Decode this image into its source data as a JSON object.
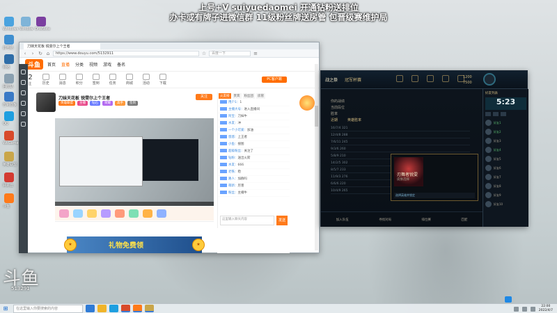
{
  "overlay": {
    "line1": "上号+V suiyuedaomei  开通钻粉送排位",
    "line2": "办卡或有牌子进微信群 11级粉丝牌送房管  包晋级赛维护局"
  },
  "desktop_icons": [
    {
      "label": "Windows",
      "color": "#4aa3df"
    },
    {
      "label": "Window",
      "color": "#7fb4d8"
    },
    {
      "label": "OneNote",
      "color": "#7b3fa0"
    },
    {
      "label": "此电脑",
      "color": "#3f8fd0"
    },
    {
      "label": "网络",
      "color": "#2f6ea8"
    },
    {
      "label": "回收站",
      "color": "#8aa0b0"
    },
    {
      "label": "控制面板",
      "color": "#3a7ac6"
    },
    {
      "label": "QQ",
      "color": "#1e9fe0"
    },
    {
      "label": "WeGame",
      "color": "#d84a2a"
    },
    {
      "label": "英雄联盟",
      "color": "#c9a64a"
    },
    {
      "label": "网易云",
      "color": "#d33a31"
    },
    {
      "label": "斗鱼",
      "color": "#ff7a1a"
    }
  ],
  "browser": {
    "tab_label": "刀妹天花板 锐雯尔上个王者",
    "url": "https://www.douyu.com/5132911",
    "search_placeholder": "百度一下",
    "site": {
      "logo": "斗鱼",
      "nav": [
        "首页",
        "直播",
        "分类",
        "视频",
        "游戏",
        "备名"
      ],
      "active_nav": "直播"
    },
    "icon_row": {
      "count": "12",
      "count_label": "关注",
      "items": [
        "历史",
        "消息",
        "积分",
        "签到",
        "任务",
        "商城",
        "活动",
        "下载"
      ]
    },
    "pc_button": "PC客户端",
    "room": {
      "title": "刀妹天花板 锐雯尔上个王者",
      "follow": "关注",
      "tags": [
        {
          "text": "英雄联盟",
          "color": "#ff7a1a"
        },
        {
          "text": "主播",
          "color": "#e84a8a"
        },
        {
          "text": "钻石",
          "color": "#6a7cff"
        },
        {
          "text": "荣耀",
          "color": "#b36af0"
        },
        {
          "text": "高手",
          "color": "#ff9a3a"
        },
        {
          "text": "签到",
          "color": "#7a7a7a"
        }
      ]
    },
    "chat": {
      "tabs": [
        "火友榜",
        "贵宾",
        "粉丝团",
        "房管"
      ],
      "selected_tab": "火友榜",
      "lines": [
        {
          "nick": "用户1",
          "text": "1"
        },
        {
          "nick": "主播大号",
          "text": "进入直播间"
        },
        {
          "nick": "阿宝",
          "text": "刀妹牛"
        },
        {
          "nick": "水友",
          "text": "冲"
        },
        {
          "nick": "一个小可爱",
          "text": "加油"
        },
        {
          "nick": "悠悠",
          "text": "上王者"
        },
        {
          "nick": "小鱼",
          "text": "搜图"
        },
        {
          "nick": "超级粉丝",
          "text": "关注了"
        },
        {
          "nick": "钻粉",
          "text": "送出火箭"
        },
        {
          "nick": "水友",
          "text": "666"
        },
        {
          "nick": "老铁",
          "text": "稳"
        },
        {
          "nick": "路人",
          "text": "加群吗"
        },
        {
          "nick": "萌新",
          "text": "厉害"
        },
        {
          "nick": "粉丝",
          "text": "主播牛"
        }
      ],
      "input_placeholder": "这里输入聊天内容",
      "send": "发送"
    },
    "banner_text": "礼物免费领"
  },
  "game": {
    "nav": [
      "战之祭",
      "冠军杯赛"
    ],
    "currency": {
      "rp": "1200",
      "be": "7500"
    },
    "info": [
      "你的战绩",
      "当前段位",
      "胜率"
    ],
    "tabs": [
      "近期",
      "英雄胜率"
    ],
    "rows": [
      "16/7/4 321",
      "12/4/8 288",
      "7/6/11 245",
      "9/3/6 260",
      "5/8/9 210",
      "14/2/5 302",
      "8/5/7 233",
      "11/9/3 276",
      "6/6/6 220",
      "10/4/9 265"
    ],
    "champion": {
      "name": "刃舞者锐雯",
      "sub": "皮肤选择",
      "bar": "选择英雄并锁定"
    },
    "bottom": [
      "加入队伍",
      "寻找对局",
      "排位赛",
      "匹配"
    ],
    "friends": {
      "title": "好友列表",
      "timer": "5:23",
      "list": [
        {
          "name": "好友1",
          "online": true
        },
        {
          "name": "好友2",
          "online": true
        },
        {
          "name": "好友3",
          "online": false
        },
        {
          "name": "好友4",
          "online": true
        },
        {
          "name": "好友5",
          "online": false
        },
        {
          "name": "好友6",
          "online": false
        },
        {
          "name": "好友7",
          "online": false
        },
        {
          "name": "好友8",
          "online": false
        },
        {
          "name": "好友9",
          "online": false
        },
        {
          "name": "好友10",
          "online": false
        }
      ]
    }
  },
  "watermark": {
    "big": "斗鱼",
    "small": "513291"
  },
  "taskbar": {
    "search_placeholder": "在这里输入你要搜索的内容",
    "apps": [
      "#2f7bd6",
      "#f0b429",
      "#1e9fe0",
      "#d84a2a",
      "#ff7a1a",
      "#c9a64a"
    ],
    "time": "22:00",
    "date": "2022/4/7"
  }
}
